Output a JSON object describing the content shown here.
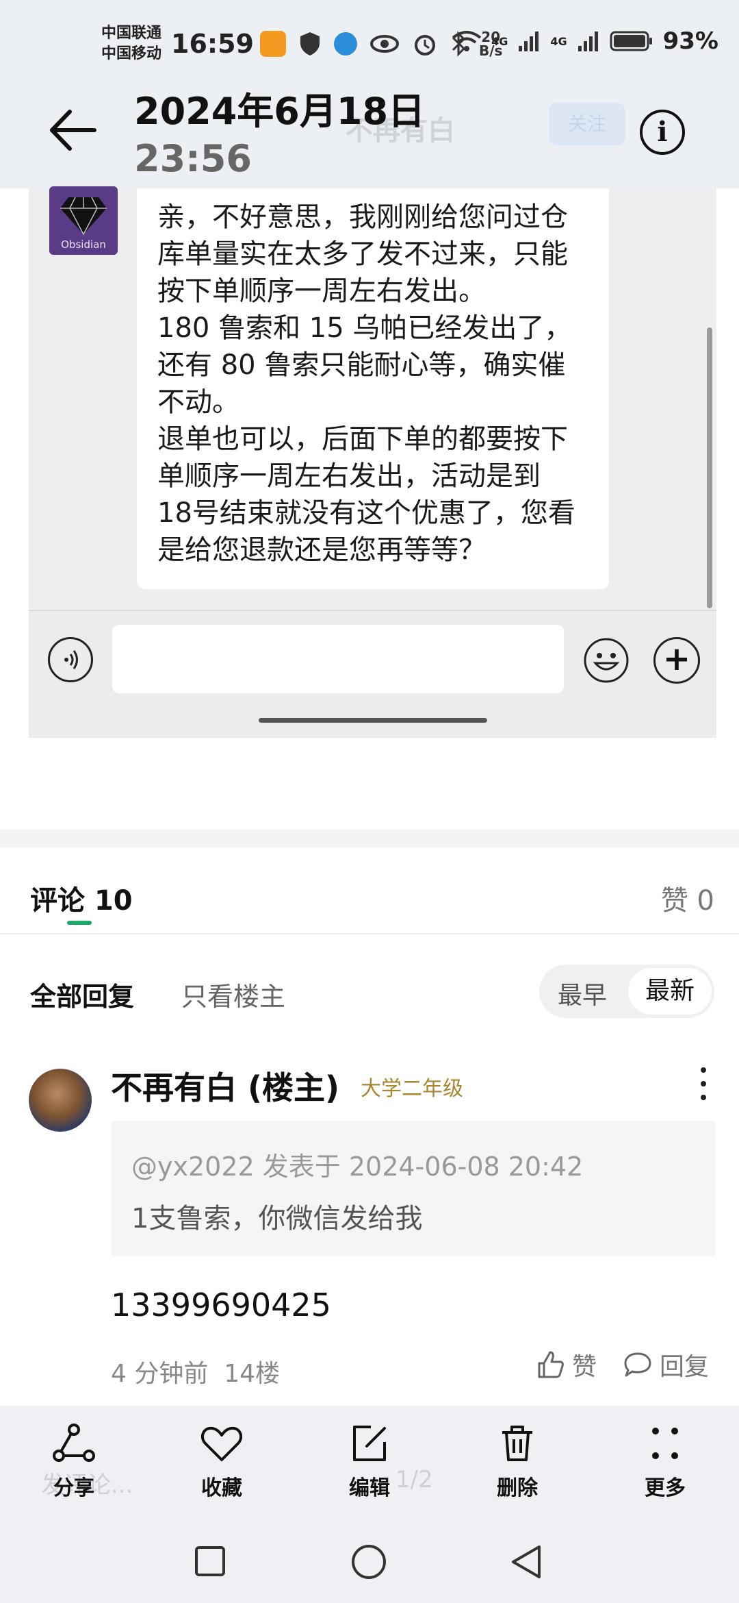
{
  "status_bar": {
    "carrier_1": "中国联通",
    "carrier_2": "中国移动",
    "time": "16:59",
    "net_speed": "20\nB/s",
    "signal_label_1": "4G",
    "signal_label_2": "4G",
    "battery": "93%"
  },
  "header": {
    "date": "2024年6月18日",
    "time": "23:56",
    "ghost_title": "不再有白",
    "ghost_follow": "关注"
  },
  "chat_screenshot": {
    "avatar_caption": "Obsidian",
    "message": "亲，不好意思，我刚刚给您问过仓\n库单量实在太多了发不过来，只能\n按下单顺序一周左右发出。\n180 鲁索和 15 乌帕已经发出了，\n还有 80 鲁索只能耐心等，确实催\n不动。\n退单也可以，后面下单的都要按下\n单顺序一周左右发出，活动是到\n18号结束就没有这个优惠了，您看\n是给您退款还是您再等等？"
  },
  "comments": {
    "tab_label": "评论",
    "count": "10",
    "likes_label": "赞",
    "likes_count": "0",
    "filter_all": "全部回复",
    "filter_op": "只看楼主",
    "sort_early": "最早",
    "sort_new": "最新",
    "item": {
      "author": "不再有白 (楼主)",
      "level": "大学二年级",
      "quote_meta": "@yx2022 发表于 2024-06-08 20:42",
      "quote_text": "1支鲁索，你微信发给我",
      "body": "13399690425",
      "time_floor": "4 分钟前  14楼",
      "like_label": "赞",
      "reply_label": "回复"
    }
  },
  "action_bar": {
    "ghost_input": "发评论...",
    "ghost_page": "1/2",
    "share": "分享",
    "collect": "收藏",
    "edit": "编辑",
    "delete": "删除",
    "more": "更多"
  }
}
